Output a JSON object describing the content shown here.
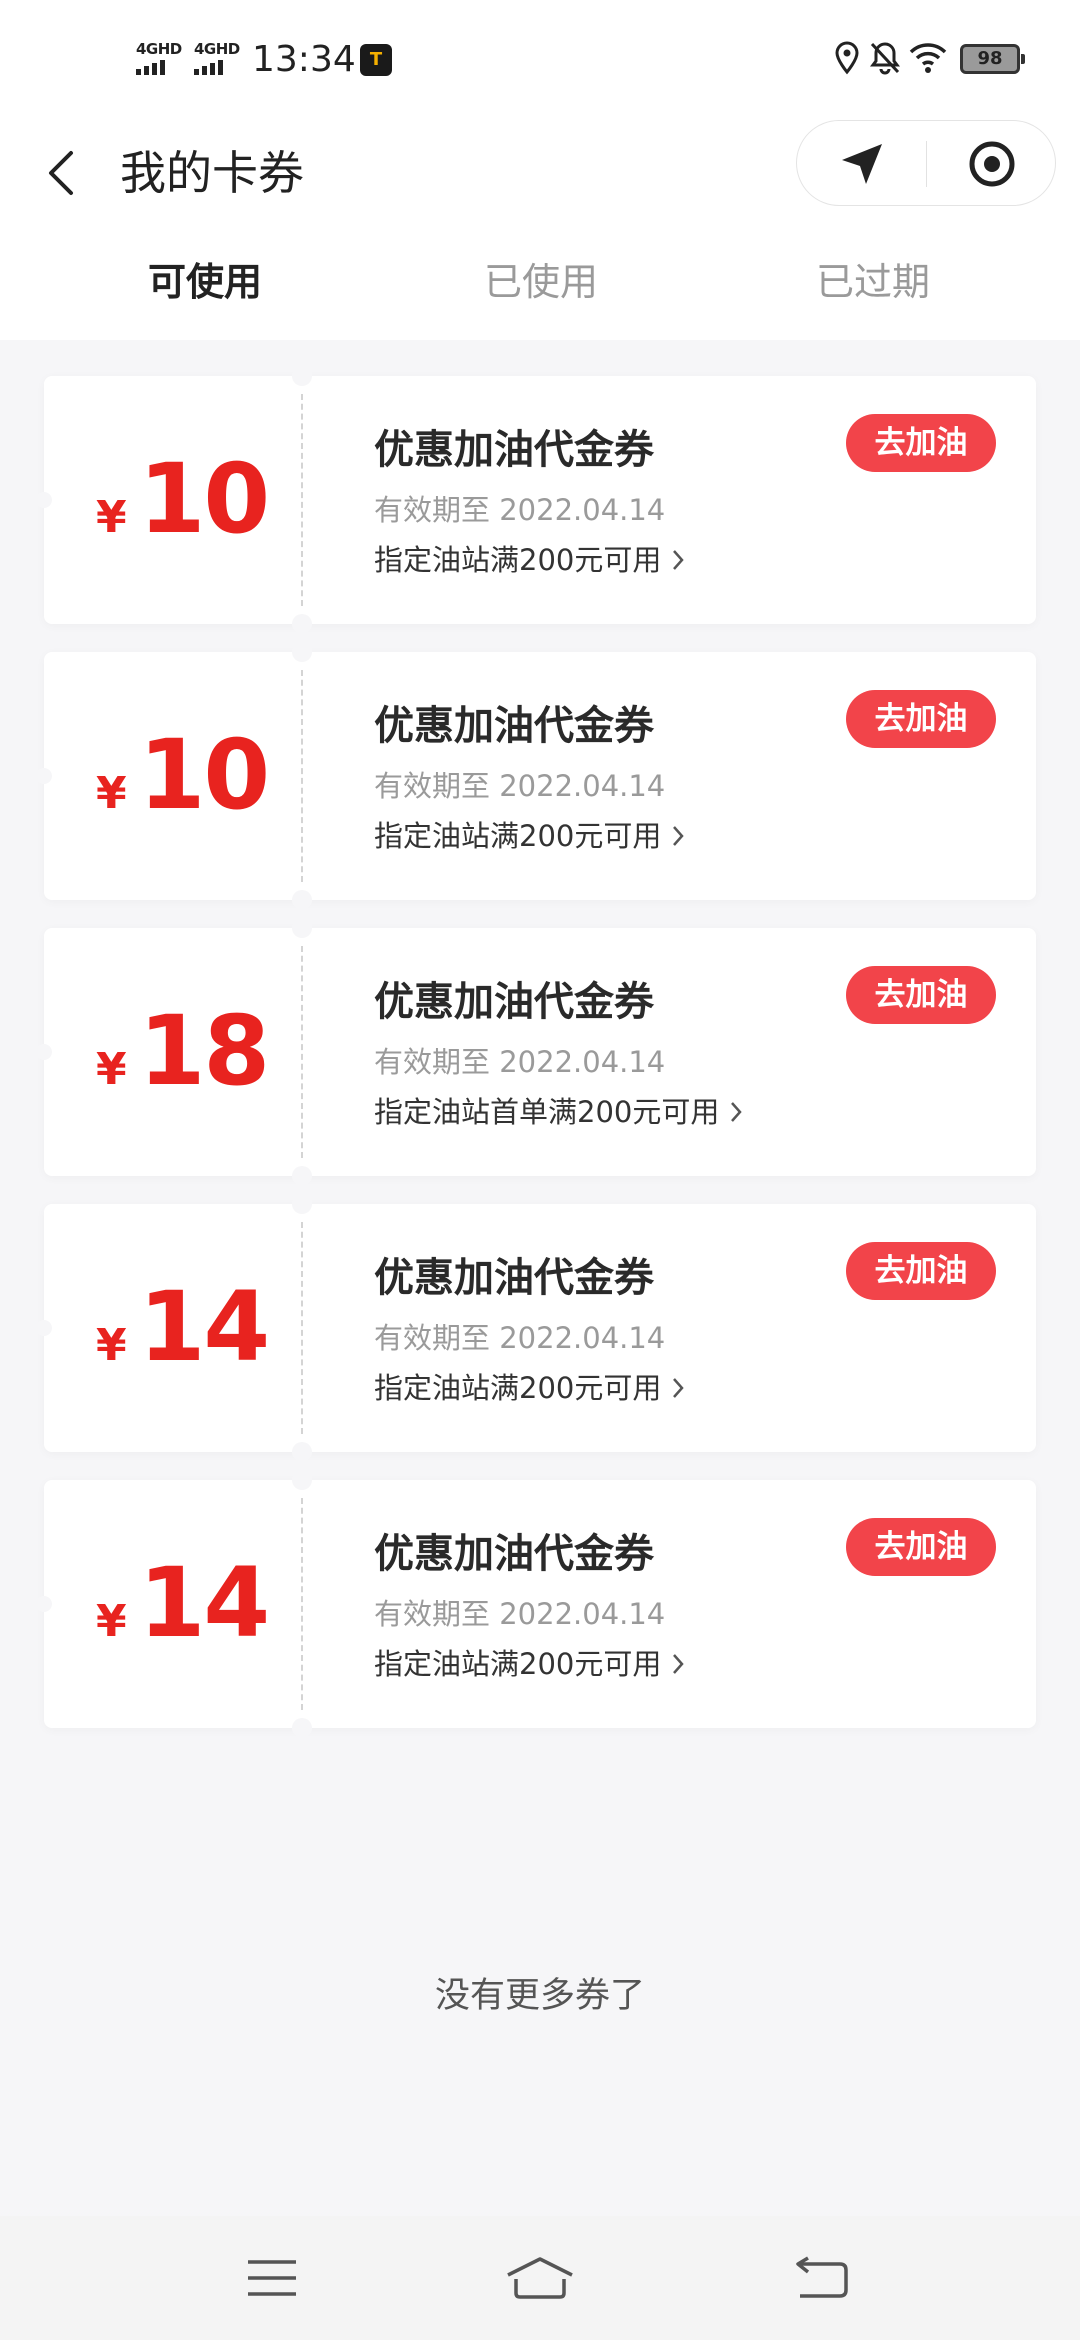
{
  "status_bar": {
    "network1": "4GHD",
    "network2": "4GHD",
    "time": "13:34",
    "app_badge": "T",
    "battery": "98"
  },
  "nav": {
    "title": "我的卡券"
  },
  "tabs": [
    {
      "label": "可使用",
      "active": true
    },
    {
      "label": "已使用",
      "active": false
    },
    {
      "label": "已过期",
      "active": false
    }
  ],
  "coupons": [
    {
      "currency": "¥",
      "amount": "10",
      "title": "优惠加油代金券",
      "expire": "有效期至 2022.04.14",
      "condition": "指定油站满200元可用",
      "button": "去加油"
    },
    {
      "currency": "¥",
      "amount": "10",
      "title": "优惠加油代金券",
      "expire": "有效期至 2022.04.14",
      "condition": "指定油站满200元可用",
      "button": "去加油"
    },
    {
      "currency": "¥",
      "amount": "18",
      "title": "优惠加油代金券",
      "expire": "有效期至 2022.04.14",
      "condition": "指定油站首单满200元可用",
      "button": "去加油"
    },
    {
      "currency": "¥",
      "amount": "14",
      "title": "优惠加油代金券",
      "expire": "有效期至 2022.04.14",
      "condition": "指定油站满200元可用",
      "button": "去加油"
    },
    {
      "currency": "¥",
      "amount": "14",
      "title": "优惠加油代金券",
      "expire": "有效期至 2022.04.14",
      "condition": "指定油站满200元可用",
      "button": "去加油"
    }
  ],
  "footer": {
    "no_more": "没有更多券了"
  },
  "colors": {
    "accent_red": "#e8231f",
    "button_red": "#f2444a",
    "background": "#f6f6f8"
  },
  "icons": [
    "location-icon",
    "bell-off-icon",
    "wifi-icon",
    "back-arrow-icon",
    "navigation-arrow-icon",
    "target-icon",
    "chevron-right-icon",
    "menu-icon",
    "home-icon",
    "return-icon"
  ]
}
